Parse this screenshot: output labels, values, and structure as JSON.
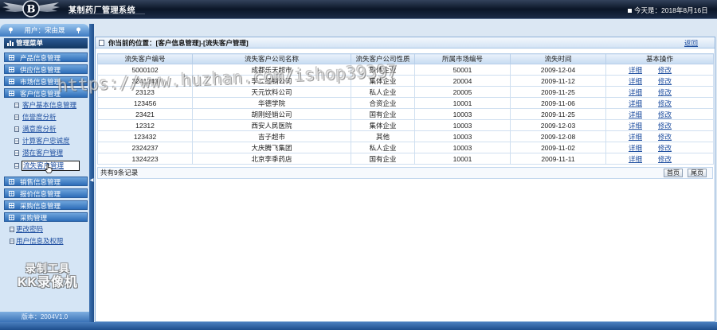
{
  "header": {
    "logo_letter": "B",
    "title": "某制药厂管理系统",
    "date_text": "今天是：2018年8月16日"
  },
  "sidebar": {
    "user_label": "用户：宋由晟",
    "menu_title": "管理菜单",
    "groups": [
      {
        "label": "产品信息管理"
      },
      {
        "label": "供应信息管理"
      },
      {
        "label": "市场信息管理"
      },
      {
        "label": "客户信息管理",
        "expanded": true,
        "children": [
          "客户基本信息管理",
          "信誉度分析",
          "满意度分析",
          "计算客户忠诚度",
          "潜在客户管理",
          "流失客户管理"
        ],
        "selected": "流失客户管理"
      },
      {
        "label": "销售信息管理"
      },
      {
        "label": "报价信息管理"
      },
      {
        "label": "采购信息管理"
      },
      {
        "label": "采购管理"
      }
    ],
    "links": [
      "更改密码",
      "用户信息及权限"
    ],
    "version": "版本：2004V1.0"
  },
  "breadcrumb": {
    "label": "你当前的位置：",
    "path": "[客户信息管理]-[流失客户管理]",
    "back_label": "返回"
  },
  "table": {
    "columns": [
      "流失客户编号",
      "流失客户公司名称",
      "流失客户公司性质",
      "所属市场编号",
      "流失时间",
      "基本操作"
    ],
    "rows": [
      {
        "id": "5000102",
        "company": "成都乐天超市",
        "type": "集体企业",
        "market": "50001",
        "date": "2009-12-04"
      },
      {
        "id": "3241243",
        "company": "李二经销公司",
        "type": "集体企业",
        "market": "20004",
        "date": "2009-11-12"
      },
      {
        "id": "23123",
        "company": "天元饮料公司",
        "type": "私人企业",
        "market": "20005",
        "date": "2009-11-25"
      },
      {
        "id": "123456",
        "company": "华德学院",
        "type": "合资企业",
        "market": "10001",
        "date": "2009-11-06"
      },
      {
        "id": "23421",
        "company": "胡刚经销公司",
        "type": "国有企业",
        "market": "10003",
        "date": "2009-11-25"
      },
      {
        "id": "12312",
        "company": "西安人民医院",
        "type": "集体企业",
        "market": "10003",
        "date": "2009-12-03"
      },
      {
        "id": "123432",
        "company": "吉子超市",
        "type": "其他",
        "market": "10003",
        "date": "2009-12-08"
      },
      {
        "id": "2324237",
        "company": "大庆腾飞集团",
        "type": "私人企业",
        "market": "10003",
        "date": "2009-11-02"
      },
      {
        "id": "1324223",
        "company": "北京李季药店",
        "type": "国有企业",
        "market": "10001",
        "date": "2009-11-11"
      }
    ],
    "actions": {
      "detail": "详细",
      "edit": "修改"
    }
  },
  "pagination": {
    "record_count": "共有9条记录",
    "first": "首页",
    "last": "尾页"
  },
  "watermarks": {
    "url": "https://www.huzhan.com/ishop39397",
    "recorder_line1": "录制工具",
    "recorder_line2": "KK录像机"
  },
  "icons": {
    "logo": "winged-b-logo",
    "date": "square-bullet-icon",
    "user_band": "pin-icon",
    "menu_title": "menu-bars-icon",
    "menu_group": "grid-icon",
    "menu_child": "page-icon",
    "breadcrumb": "location-icon",
    "splitter": "collapse-arrow-icon",
    "cursor": "hand-cursor-icon"
  },
  "colors": {
    "header_bg": "#0b1628",
    "accent": "#2d6db8",
    "accent_light": "#6ea5dc",
    "link": "#1f4fa0",
    "panel_border": "#8db1d8",
    "sidebar_bg": "#d5e5f5",
    "row_border": "#cfdff0"
  }
}
